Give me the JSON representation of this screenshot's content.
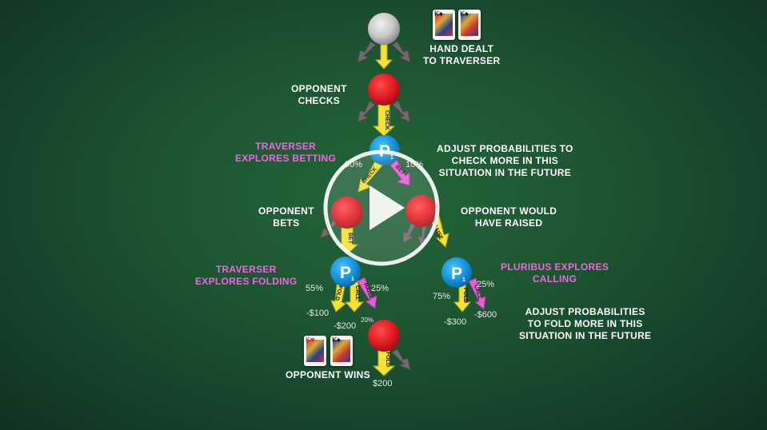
{
  "labels": {
    "hand_dealt": "HAND DEALT\nTO TRAVERSER",
    "opponent_checks": "OPPONENT\nCHECKS",
    "traverser_explores_betting": "TRAVERSER\nEXPLORES BETTING",
    "adjust_check": "ADJUST PROBABILITIES TO\nCHECK MORE IN THIS\nSITUATION IN THE FUTURE",
    "opponent_bets": "OPPONENT\nBETS",
    "opponent_would_have_raised": "OPPONENT WOULD\nHAVE RAISED",
    "traverser_explores_folding": "TRAVERSER\nEXPLORES FOLDING",
    "pluribus_explores_calling": "PLURIBUS EXPLORES\nCALLING",
    "adjust_fold": "ADJUST PROBABILITIES\nTO FOLD MORE IN THIS\nSITUATION IN THE FUTURE",
    "opponent_wins": "OPPONENT WINS"
  },
  "nodes": {
    "player_symbol": "P",
    "player_subscript": "1"
  },
  "actions": {
    "check": "CHECK",
    "bet": "BET",
    "raise": "RAISE",
    "fold": "FOLD",
    "call": "CALL"
  },
  "percentages": {
    "check_pct": "90%",
    "bet_pct": "10%",
    "fold_pct_left": "55%",
    "raise_pct_left": "25%",
    "call_pct_left": "20%",
    "fold_pct_right": "75%",
    "call_pct_right": "25%"
  },
  "amounts": {
    "fold_left": "-$100",
    "call_left": "-$200",
    "fold_right": "-$300",
    "call_right": "-$600",
    "opponent_wins": "$200"
  },
  "cards": {
    "top": [
      "K♠",
      "K♠"
    ],
    "bottom": [
      "K♥",
      "K♠"
    ]
  },
  "colors": {
    "table_felt": "#1d5531",
    "opponent_node": "#e01e24",
    "traverser_node": "#1696de",
    "start_node": "#c8c8c8",
    "explore_text": "#ee66e0",
    "yellow_arrow": "#f4e235",
    "pink_arrow": "#e25fd6",
    "gray_arrow": "#6f6b6b"
  },
  "media": {
    "play_icon": "play-icon"
  }
}
